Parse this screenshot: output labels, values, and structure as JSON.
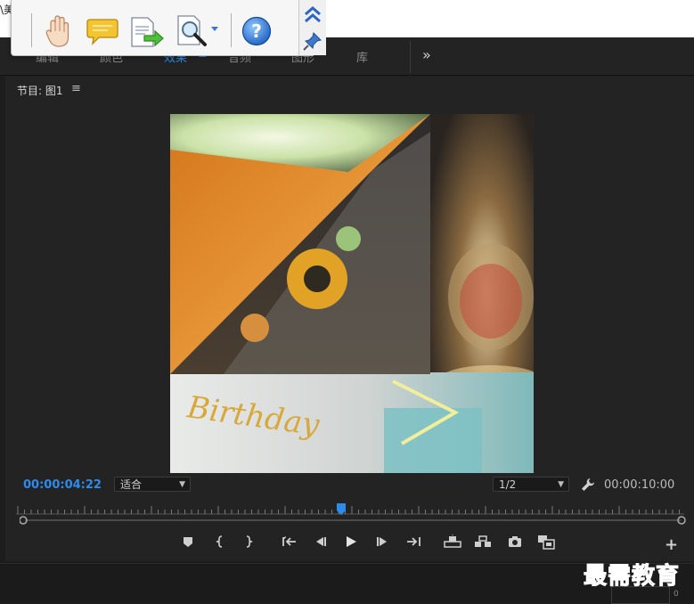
{
  "topbar": {
    "text": "\\美"
  },
  "workspace": {
    "tabs": [
      "编辑",
      "颜色",
      "效果",
      "音频",
      "图形",
      "库"
    ],
    "menu_glyph": "≡",
    "more": "»"
  },
  "toolbar": {
    "icons": [
      "hand-icon",
      "comment-icon",
      "export-icon",
      "zoom-icon",
      "help-icon",
      "collapse-up-icon",
      "pin-icon"
    ],
    "help_label": "?"
  },
  "program_monitor": {
    "title": "节目: 图1",
    "menu_glyph": "≡",
    "current_time": "00:00:04:22",
    "duration": "00:00:10:00",
    "zoom_select": "适合",
    "resolution_select": "1/2",
    "playhead_fraction": 0.49
  },
  "controls": {
    "icons": [
      "marker-icon",
      "mark-in-icon",
      "mark-out-icon",
      "go-to-in-icon",
      "step-back-icon",
      "play-icon",
      "step-forward-icon",
      "go-to-out-icon",
      "lift-icon",
      "extract-icon",
      "export-frame-icon",
      "comparison-view-icon",
      "add-button-icon"
    ],
    "add_label": "+"
  },
  "watermark": {
    "text": "最需教育"
  },
  "mini": {
    "zero": "0"
  },
  "colors": {
    "accent": "#2d8ceb",
    "panel": "#232323",
    "background": "#1d1d1d"
  }
}
